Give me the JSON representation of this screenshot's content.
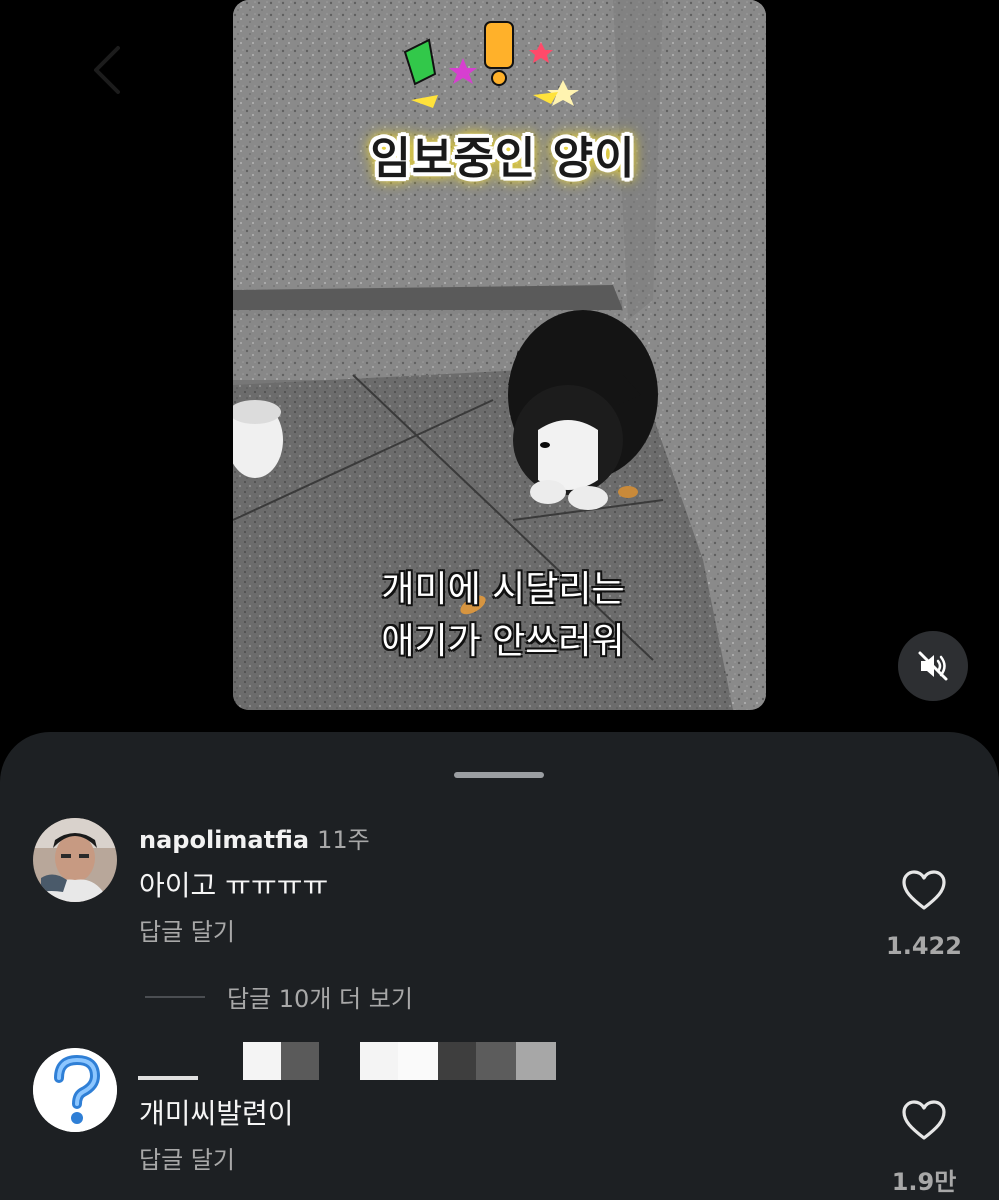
{
  "video": {
    "title_sticker": "임보중인 양이",
    "caption_line1": "개미에 시달리는",
    "caption_line2": "애기가 안쓰러워"
  },
  "comments": [
    {
      "username": "napolimatfia",
      "time": "11주",
      "text": "아이고 ㅠㅠㅠㅠ",
      "reply_label": "답글 달기",
      "likes": "1.422"
    },
    {
      "username": "",
      "time": "",
      "text": "개미씨발련이",
      "reply_label": "답글 달기",
      "likes": "1.9만"
    }
  ],
  "more_replies": "답글 10개 더 보기",
  "icons": {
    "back": "chevron-left-icon",
    "mute": "speaker-muted-icon",
    "like": "heart-outline-icon"
  },
  "colors": {
    "background": "#000000",
    "sheet": "#1d2023",
    "secondary_text": "#a8a8a8"
  }
}
